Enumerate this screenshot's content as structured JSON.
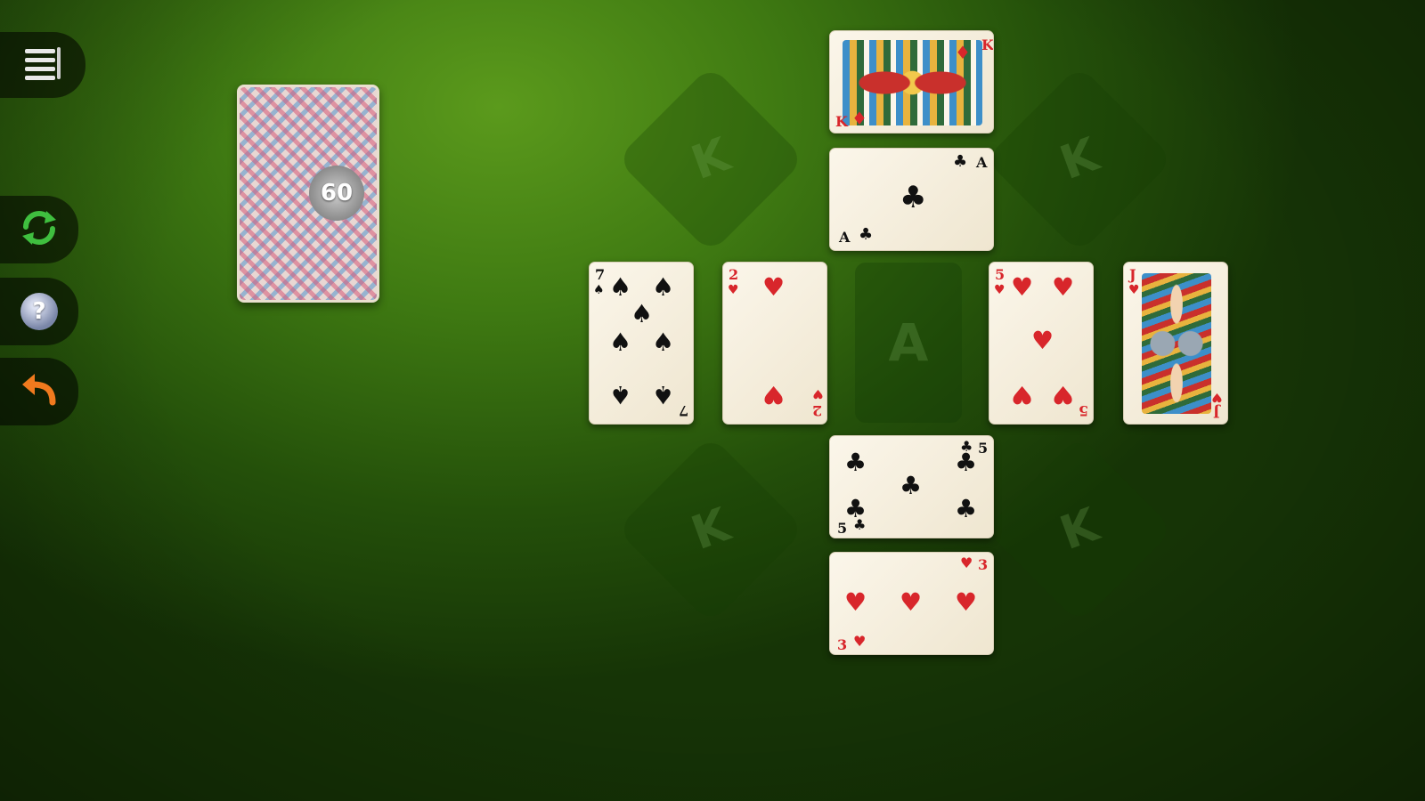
{
  "toolbar": {
    "menu_icon": "menu-icon",
    "new_game_icon": "refresh-icon",
    "help_icon": "help-icon",
    "help_glyph": "?",
    "undo_icon": "undo-icon"
  },
  "stock": {
    "count": "60"
  },
  "placeholders": {
    "king_label": "K",
    "ace_label": "A"
  },
  "cards": {
    "top_king": {
      "rank": "K",
      "suit": "♦",
      "color": "red"
    },
    "top_ace": {
      "rank": "A",
      "suit": "♣",
      "color": "black"
    },
    "seven_spades": {
      "rank": "7",
      "suit": "♠",
      "color": "black"
    },
    "two_hearts": {
      "rank": "2",
      "suit": "♥",
      "color": "red"
    },
    "five_hearts": {
      "rank": "5",
      "suit": "♥",
      "color": "red"
    },
    "jack_hearts": {
      "rank": "J",
      "suit": "♥",
      "color": "red"
    },
    "five_clubs": {
      "rank": "5",
      "suit": "♣",
      "color": "black"
    },
    "three_hearts": {
      "rank": "3",
      "suit": "♥",
      "color": "red"
    }
  },
  "colors": {
    "felt_light": "#5b9a1c",
    "felt_dark": "#163406",
    "card_red": "#d8262b",
    "card_black": "#111111",
    "refresh_green": "#3fbf3f",
    "undo_orange": "#f07a1e"
  }
}
